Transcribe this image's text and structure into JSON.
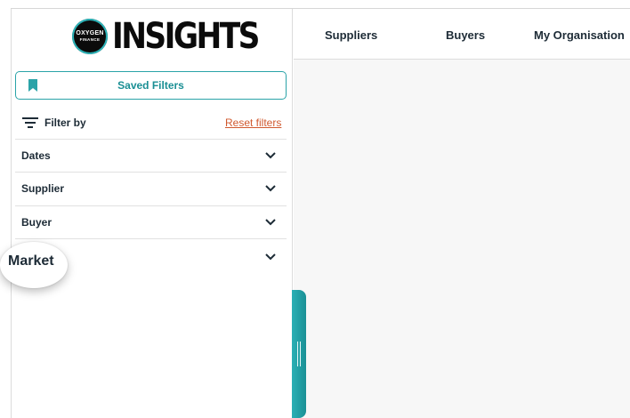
{
  "brand": {
    "badge_line1": "OXYGEN",
    "badge_line2": "FINANCE",
    "wordmark": "INSIGHTS",
    "accent_color": "#2aa3a8"
  },
  "topnav": {
    "items": [
      "Suppliers",
      "Buyers",
      "My Organisation"
    ]
  },
  "sidebar": {
    "saved_filters_label": "Saved Filters",
    "filter_by_label": "Filter by",
    "reset_label": "Reset filters",
    "facets": [
      "Dates",
      "Supplier",
      "Buyer",
      "Market"
    ]
  },
  "icons": {
    "saved": "bookmark-icon",
    "filter": "filter-icon",
    "expand": "chevron-down-icon",
    "handle": "resize-grip-icon"
  }
}
